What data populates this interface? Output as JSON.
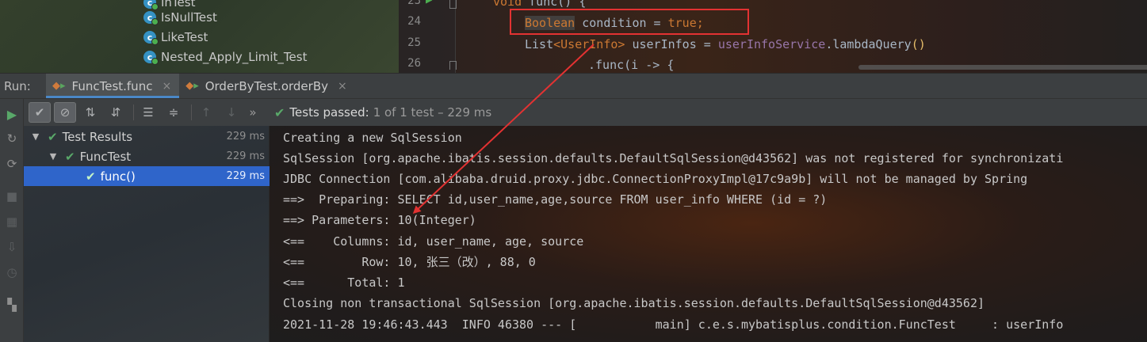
{
  "project_tree": {
    "items": [
      {
        "label": "InTest",
        "icon": "test-class-icon"
      },
      {
        "label": "IsNullTest",
        "icon": "test-class-icon"
      },
      {
        "label": "LikeTest",
        "icon": "test-class-icon"
      },
      {
        "label": "Nested_Apply_Limit_Test",
        "icon": "test-class-icon"
      }
    ]
  },
  "editor": {
    "line_numbers": [
      "23",
      "24",
      "25",
      "26"
    ],
    "line23": {
      "kw": "void",
      "rest": " func() {"
    },
    "line24": {
      "type": "Boolean",
      "mid": " condition = ",
      "val": "true",
      "end": ";"
    },
    "line25": {
      "a": "List",
      "b": "<UserInfo>",
      "c": " userInfos = ",
      "d": "userInfoService",
      "e": ".lambdaQuery",
      "f": "()"
    },
    "line26": {
      "text": ".func(i -> {"
    }
  },
  "run": {
    "label": "Run:",
    "tabs": [
      {
        "label": "FuncTest.func",
        "close": "×"
      },
      {
        "label": "OrderByTest.orderBy",
        "close": "×"
      }
    ]
  },
  "toolbar": {
    "more": "»"
  },
  "status": {
    "strong": "Tests passed:",
    "rest": "1 of 1 test – 229 ms"
  },
  "test_tree": {
    "nodes": [
      {
        "label": "Test Results",
        "duration": "229 ms"
      },
      {
        "label": "FuncTest",
        "duration": "229 ms"
      },
      {
        "label": "func()",
        "duration": "229 ms"
      }
    ]
  },
  "console": {
    "lines": [
      "Creating a new SqlSession",
      "SqlSession [org.apache.ibatis.session.defaults.DefaultSqlSession@d43562] was not registered for synchronizati",
      "JDBC Connection [com.alibaba.druid.proxy.jdbc.ConnectionProxyImpl@17c9a9b] will not be managed by Spring",
      "==>  Preparing: SELECT id,user_name,age,source FROM user_info WHERE (id = ?)",
      "==> Parameters: 10(Integer)",
      "<==    Columns: id, user_name, age, source",
      "<==        Row: 10, 张三（改）, 88, 0",
      "<==      Total: 1",
      "Closing non transactional SqlSession [org.apache.ibatis.session.defaults.DefaultSqlSession@d43562]",
      "2021-11-28 19:46:43.443  INFO 46380 --- [           main] c.e.s.mybatisplus.condition.FuncTest     : userInfo"
    ]
  },
  "colors": {
    "annotation_red": "#e33232",
    "pass_green": "#59a869",
    "selection_blue": "#2f65ca"
  }
}
